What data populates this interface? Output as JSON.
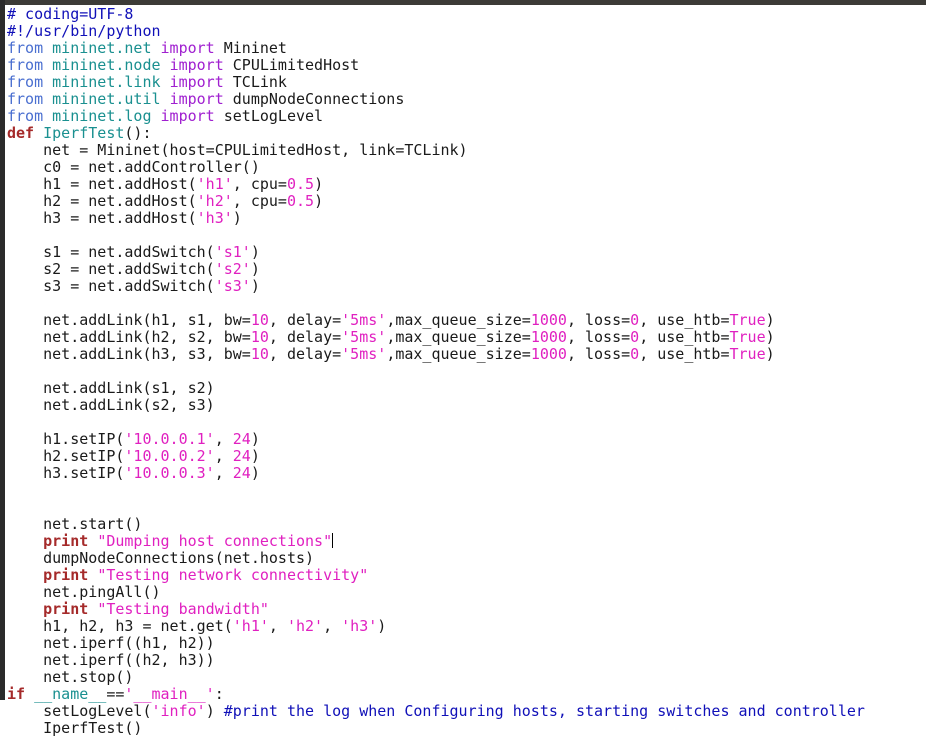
{
  "editor": {
    "cursor_line": 31,
    "lines": [
      [
        [
          "# coding=UTF-8",
          "comment"
        ]
      ],
      [
        [
          "#!/usr/bin/python",
          "comment"
        ]
      ],
      [
        [
          "from",
          "from"
        ],
        [
          " ",
          ""
        ],
        [
          "mininet.net",
          "mod"
        ],
        [
          " ",
          ""
        ],
        [
          "import",
          "import"
        ],
        [
          " Mininet",
          ""
        ]
      ],
      [
        [
          "from",
          "from"
        ],
        [
          " ",
          ""
        ],
        [
          "mininet.node",
          "mod"
        ],
        [
          " ",
          ""
        ],
        [
          "import",
          "import"
        ],
        [
          " CPULimitedHost",
          ""
        ]
      ],
      [
        [
          "from",
          "from"
        ],
        [
          " ",
          ""
        ],
        [
          "mininet.link",
          "mod"
        ],
        [
          " ",
          ""
        ],
        [
          "import",
          "import"
        ],
        [
          " TCLink",
          ""
        ]
      ],
      [
        [
          "from",
          "from"
        ],
        [
          " ",
          ""
        ],
        [
          "mininet.util",
          "mod"
        ],
        [
          " ",
          ""
        ],
        [
          "import",
          "import"
        ],
        [
          " dumpNodeConnections",
          ""
        ]
      ],
      [
        [
          "from",
          "from"
        ],
        [
          " ",
          ""
        ],
        [
          "mininet.log",
          "mod"
        ],
        [
          " ",
          ""
        ],
        [
          "import",
          "import"
        ],
        [
          " setLogLevel",
          ""
        ]
      ],
      [
        [
          "def",
          "kw"
        ],
        [
          " ",
          ""
        ],
        [
          "IperfTest",
          "fn"
        ],
        [
          "():",
          ""
        ]
      ],
      [
        [
          "    net = Mininet(host=CPULimitedHost, link=TCLink)",
          ""
        ]
      ],
      [
        [
          "    c0 = net.addController()",
          ""
        ]
      ],
      [
        [
          "    h1 = net.addHost(",
          ""
        ],
        [
          "'h1'",
          "str"
        ],
        [
          ", cpu=",
          ""
        ],
        [
          "0.5",
          "num"
        ],
        [
          ")",
          ""
        ]
      ],
      [
        [
          "    h2 = net.addHost(",
          ""
        ],
        [
          "'h2'",
          "str"
        ],
        [
          ", cpu=",
          ""
        ],
        [
          "0.5",
          "num"
        ],
        [
          ")",
          ""
        ]
      ],
      [
        [
          "    h3 = net.addHost(",
          ""
        ],
        [
          "'h3'",
          "str"
        ],
        [
          ")",
          ""
        ]
      ],
      [],
      [
        [
          "    s1 = net.addSwitch(",
          ""
        ],
        [
          "'s1'",
          "str"
        ],
        [
          ")",
          ""
        ]
      ],
      [
        [
          "    s2 = net.addSwitch(",
          ""
        ],
        [
          "'s2'",
          "str"
        ],
        [
          ")",
          ""
        ]
      ],
      [
        [
          "    s3 = net.addSwitch(",
          ""
        ],
        [
          "'s3'",
          "str"
        ],
        [
          ")",
          ""
        ]
      ],
      [],
      [
        [
          "    net.addLink(h1, s1, bw=",
          ""
        ],
        [
          "10",
          "num"
        ],
        [
          ", delay=",
          ""
        ],
        [
          "'5ms'",
          "str"
        ],
        [
          ",max_queue_size=",
          ""
        ],
        [
          "1000",
          "num"
        ],
        [
          ", loss=",
          ""
        ],
        [
          "0",
          "num"
        ],
        [
          ", use_htb=",
          ""
        ],
        [
          "True",
          "num"
        ],
        [
          ")",
          ""
        ]
      ],
      [
        [
          "    net.addLink(h2, s2, bw=",
          ""
        ],
        [
          "10",
          "num"
        ],
        [
          ", delay=",
          ""
        ],
        [
          "'5ms'",
          "str"
        ],
        [
          ",max_queue_size=",
          ""
        ],
        [
          "1000",
          "num"
        ],
        [
          ", loss=",
          ""
        ],
        [
          "0",
          "num"
        ],
        [
          ", use_htb=",
          ""
        ],
        [
          "True",
          "num"
        ],
        [
          ")",
          ""
        ]
      ],
      [
        [
          "    net.addLink(h3, s3, bw=",
          ""
        ],
        [
          "10",
          "num"
        ],
        [
          ", delay=",
          ""
        ],
        [
          "'5ms'",
          "str"
        ],
        [
          ",max_queue_size=",
          ""
        ],
        [
          "1000",
          "num"
        ],
        [
          ", loss=",
          ""
        ],
        [
          "0",
          "num"
        ],
        [
          ", use_htb=",
          ""
        ],
        [
          "True",
          "num"
        ],
        [
          ")",
          ""
        ]
      ],
      [],
      [
        [
          "    net.addLink(s1, s2)",
          ""
        ]
      ],
      [
        [
          "    net.addLink(s2, s3)",
          ""
        ]
      ],
      [],
      [
        [
          "    h1.setIP(",
          ""
        ],
        [
          "'10.0.0.1'",
          "str"
        ],
        [
          ", ",
          ""
        ],
        [
          "24",
          "num"
        ],
        [
          ")",
          ""
        ]
      ],
      [
        [
          "    h2.setIP(",
          ""
        ],
        [
          "'10.0.0.2'",
          "str"
        ],
        [
          ", ",
          ""
        ],
        [
          "24",
          "num"
        ],
        [
          ")",
          ""
        ]
      ],
      [
        [
          "    h3.setIP(",
          ""
        ],
        [
          "'10.0.0.3'",
          "str"
        ],
        [
          ", ",
          ""
        ],
        [
          "24",
          "num"
        ],
        [
          ")",
          ""
        ]
      ],
      [],
      [],
      [
        [
          "    net.start()",
          ""
        ]
      ],
      [
        [
          "    ",
          ""
        ],
        [
          "print",
          "kw"
        ],
        [
          " ",
          ""
        ],
        [
          "\"Dumping host connections\"",
          "str"
        ]
      ],
      [
        [
          "    dumpNodeConnections(net.hosts)",
          ""
        ]
      ],
      [
        [
          "    ",
          ""
        ],
        [
          "print",
          "kw"
        ],
        [
          " ",
          ""
        ],
        [
          "\"Testing network connectivity\"",
          "str"
        ]
      ],
      [
        [
          "    net.pingAll()",
          ""
        ]
      ],
      [
        [
          "    ",
          ""
        ],
        [
          "print",
          "kw"
        ],
        [
          " ",
          ""
        ],
        [
          "\"Testing bandwidth\"",
          "str"
        ]
      ],
      [
        [
          "    h1, h2, h3 = net.get(",
          ""
        ],
        [
          "'h1'",
          "str"
        ],
        [
          ", ",
          ""
        ],
        [
          "'h2'",
          "str"
        ],
        [
          ", ",
          ""
        ],
        [
          "'h3'",
          "str"
        ],
        [
          ")",
          ""
        ]
      ],
      [
        [
          "    net.iperf((h1, h2))",
          ""
        ]
      ],
      [
        [
          "    net.iperf((h2, h3))",
          ""
        ]
      ],
      [
        [
          "    net.stop()",
          ""
        ]
      ],
      [
        [
          "if",
          "kw"
        ],
        [
          " ",
          ""
        ],
        [
          "__name__",
          "dunder"
        ],
        [
          "==",
          ""
        ],
        [
          "'__main__'",
          "str"
        ],
        [
          ":",
          ""
        ]
      ],
      [
        [
          "    setLogLevel(",
          ""
        ],
        [
          "'info'",
          "str"
        ],
        [
          ") ",
          ""
        ],
        [
          "#print the log when Configuring hosts, starting switches and controller",
          "comment"
        ]
      ],
      [
        [
          "    IperfTest()",
          ""
        ]
      ]
    ]
  }
}
